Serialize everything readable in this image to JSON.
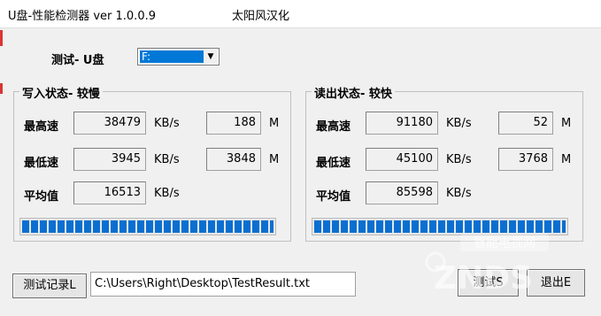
{
  "window": {
    "title": "U盘-性能检测器  ver 1.0.0.9",
    "title_right": "太阳风汉化"
  },
  "drive": {
    "label": "测试- U盘",
    "selected": "F:"
  },
  "write_group": {
    "title": "写入状态- 较慢",
    "max_label": "最高速",
    "min_label": "最低速",
    "avg_label": "平均值",
    "max_value": "38479",
    "max_mb": "188",
    "min_value": "3945",
    "min_mb": "3848",
    "avg_value": "16513",
    "unit_speed": "KB/s",
    "unit_size": "M",
    "progress": 1.0
  },
  "read_group": {
    "title": "读出状态- 较快",
    "max_label": "最高速",
    "min_label": "最低速",
    "avg_label": "平均值",
    "max_value": "91180",
    "max_mb": "52",
    "min_value": "45100",
    "min_mb": "3768",
    "avg_value": "85598",
    "unit_speed": "KB/s",
    "unit_size": "M",
    "progress": 1.0
  },
  "bottom": {
    "log_button": "测试记录L",
    "log_path": "C:\\Users\\Right\\Desktop\\TestResult.txt",
    "test_button": "测试S",
    "exit_button": "退出E"
  },
  "watermark": {
    "text": "智能电视网",
    "brand": "ZNDS"
  },
  "colors": {
    "progress": "#0b6fd1",
    "selection": "#0078d7"
  }
}
